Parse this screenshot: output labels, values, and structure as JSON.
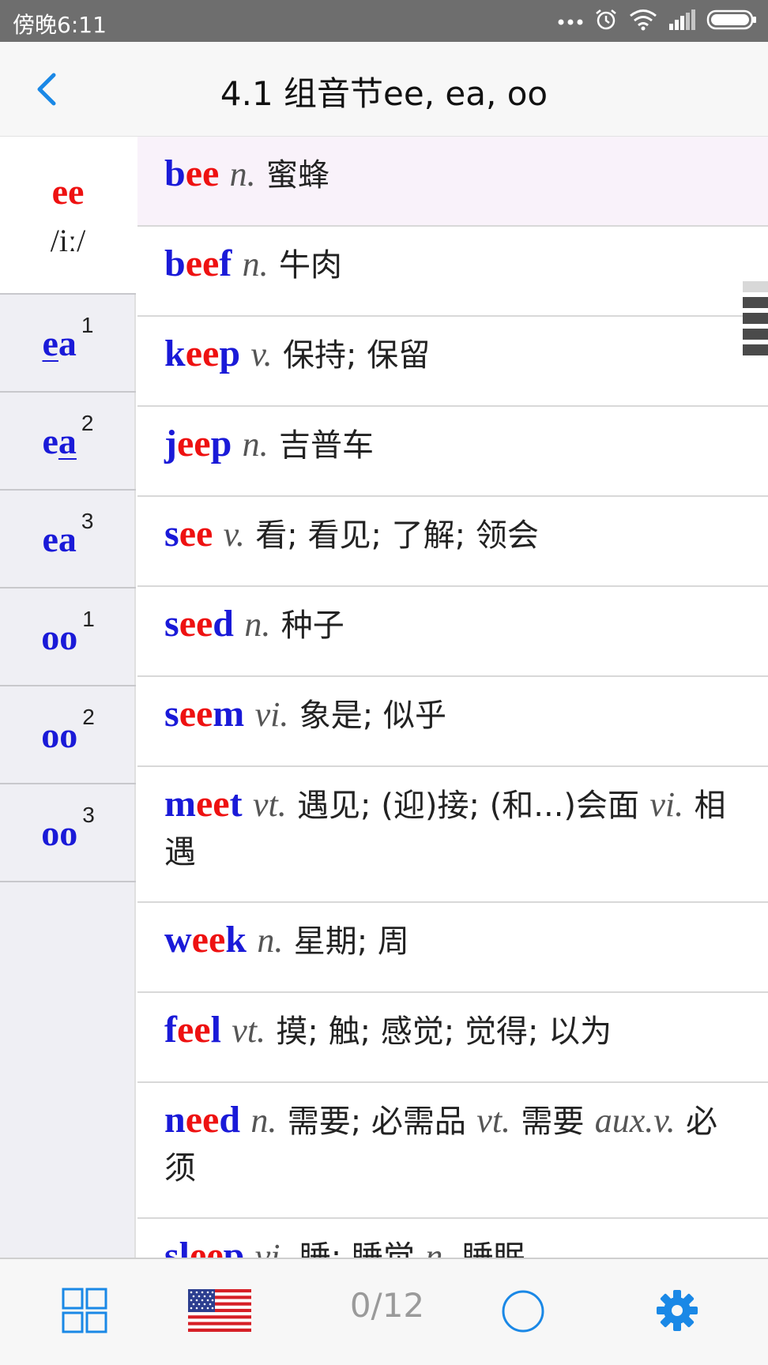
{
  "status_bar": {
    "time": "傍晚6:11",
    "icons": [
      "more-dots-icon",
      "alarm-icon",
      "wifi-icon",
      "signal-icon",
      "battery-icon"
    ]
  },
  "header": {
    "title": "4.1 组音节ee, ea, oo",
    "back_icon": "chevron-left-icon"
  },
  "sidebar": {
    "items": [
      {
        "label": "ee",
        "phonetic": "/iː/",
        "sup": "",
        "active": true
      },
      {
        "label": "ea",
        "sup": "1"
      },
      {
        "label": "ea",
        "sup": "2"
      },
      {
        "label": "ea",
        "sup": "3"
      },
      {
        "label": "oo",
        "sup": "1"
      },
      {
        "label": "oo",
        "sup": "2"
      },
      {
        "label": "oo",
        "sup": "3"
      }
    ]
  },
  "words": [
    {
      "word": "bee",
      "pos": "n.",
      "def": "蜜蜂"
    },
    {
      "word": "beef",
      "pos": "n.",
      "def": "牛肉"
    },
    {
      "word": "keep",
      "pos": "v.",
      "def": "保持; 保留"
    },
    {
      "word": "jeep",
      "pos": "n.",
      "def": "吉普车"
    },
    {
      "word": "see",
      "pos": "v.",
      "def": "看; 看见; 了解; 领会"
    },
    {
      "word": "seed",
      "pos": "n.",
      "def": "种子"
    },
    {
      "word": "seem",
      "pos": "vi.",
      "def": "象是; 似乎"
    },
    {
      "word": "meet",
      "pos": "vt.",
      "def": "遇见; (迎)接; (和...)会面",
      "pos2": "vi.",
      "def2": "相遇"
    },
    {
      "word": "week",
      "pos": "n.",
      "def": "星期; 周"
    },
    {
      "word": "feel",
      "pos": "vt.",
      "def": "摸; 触; 感觉; 觉得; 以为"
    },
    {
      "word": "need",
      "pos": "n.",
      "def": "需要; 必需品",
      "pos2": "vt.",
      "def2": "需要",
      "pos3": "aux.v.",
      "def3": "必须"
    },
    {
      "word": "sleep",
      "pos": "vi.",
      "def": "睡; 睡觉",
      "pos2": "n.",
      "def2": "睡眠"
    }
  ],
  "bottom_bar": {
    "progress": "0/12",
    "colors": {
      "accent": "#1a88e6",
      "letter_blue": "#1a1ad8",
      "letter_red": "#ee1111"
    }
  }
}
